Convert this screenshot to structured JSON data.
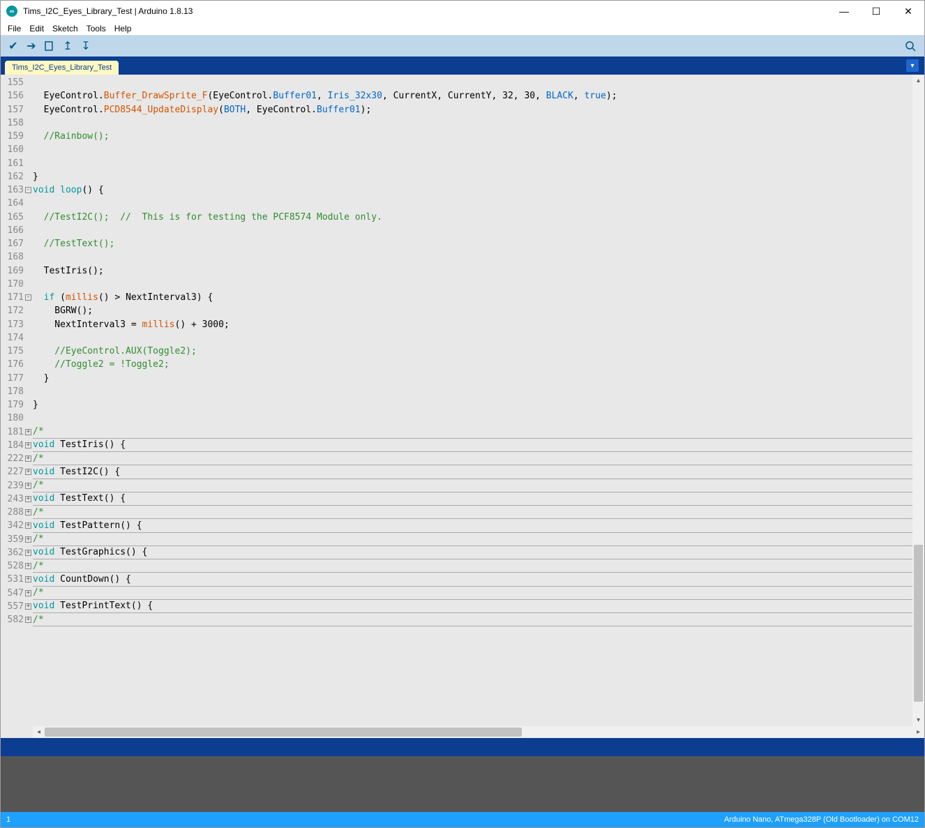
{
  "window": {
    "title": "Tims_I2C_Eyes_Library_Test | Arduino 1.8.13"
  },
  "menu": {
    "file": "File",
    "edit": "Edit",
    "sketch": "Sketch",
    "tools": "Tools",
    "help": "Help"
  },
  "tab": {
    "name": "Tims_I2C_Eyes_Library_Test"
  },
  "status": {
    "left": "1",
    "right": "Arduino Nano, ATmega328P (Old Bootloader) on COM12"
  },
  "gutter": [
    {
      "n": "155"
    },
    {
      "n": "156"
    },
    {
      "n": "157"
    },
    {
      "n": "158"
    },
    {
      "n": "159"
    },
    {
      "n": "160"
    },
    {
      "n": "161"
    },
    {
      "n": "162"
    },
    {
      "n": "163",
      "f": "-"
    },
    {
      "n": "164"
    },
    {
      "n": "165"
    },
    {
      "n": "166"
    },
    {
      "n": "167"
    },
    {
      "n": "168"
    },
    {
      "n": "169"
    },
    {
      "n": "170"
    },
    {
      "n": "171",
      "f": "-"
    },
    {
      "n": "172"
    },
    {
      "n": "173"
    },
    {
      "n": "174"
    },
    {
      "n": "175"
    },
    {
      "n": "176"
    },
    {
      "n": "177"
    },
    {
      "n": "178"
    },
    {
      "n": "179"
    },
    {
      "n": "180"
    },
    {
      "n": "181",
      "f": "+"
    },
    {
      "n": "184",
      "f": "+"
    },
    {
      "n": "222",
      "f": "+"
    },
    {
      "n": "227",
      "f": "+"
    },
    {
      "n": "239",
      "f": "+"
    },
    {
      "n": "243",
      "f": "+"
    },
    {
      "n": "288",
      "f": "+"
    },
    {
      "n": "342",
      "f": "+"
    },
    {
      "n": "359",
      "f": "+"
    },
    {
      "n": "362",
      "f": "+"
    },
    {
      "n": "528",
      "f": "+"
    },
    {
      "n": "531",
      "f": "+"
    },
    {
      "n": "547",
      "f": "+"
    },
    {
      "n": "557",
      "f": "+"
    },
    {
      "n": "582",
      "f": "+"
    }
  ],
  "code": {
    "l155": "",
    "l156_a": "  EyeControl.",
    "l156_b": "Buffer_DrawSprite_F",
    "l156_c": "(EyeControl.",
    "l156_d": "Buffer01",
    "l156_e": ", ",
    "l156_f": "Iris_32x30",
    "l156_g": ", CurrentX, CurrentY, 32, 30, ",
    "l156_h": "BLACK",
    "l156_i": ", ",
    "l156_j": "true",
    "l156_k": ");",
    "l157_a": "  EyeControl.",
    "l157_b": "PCD8544_UpdateDisplay",
    "l157_c": "(",
    "l157_d": "BOTH",
    "l157_e": ", EyeControl.",
    "l157_f": "Buffer01",
    "l157_g": ");",
    "l158": "",
    "l159": "  //Rainbow();",
    "l160": "",
    "l161": "",
    "l162": "}",
    "l163_a": "void",
    "l163_b": " ",
    "l163_c": "loop",
    "l163_d": "() {",
    "l164": "",
    "l165": "  //TestI2C();  //  This is for testing the PCF8574 Module only.",
    "l166": "",
    "l167": "  //TestText();",
    "l168": "",
    "l169": "  TestIris();",
    "l170": "",
    "l171_a": "  ",
    "l171_b": "if",
    "l171_c": " (",
    "l171_d": "millis",
    "l171_e": "() > NextInterval3) {",
    "l172": "    BGRW();",
    "l173_a": "    NextInterval3 = ",
    "l173_b": "millis",
    "l173_c": "() + 3000;",
    "l174": "",
    "l175": "    //EyeControl.AUX(Toggle2);",
    "l176": "    //Toggle2 = !Toggle2;",
    "l177": "  }",
    "l178": "",
    "l179": "}",
    "l180": "",
    "l181": "/*",
    "l184_a": "void",
    "l184_b": " TestIris() {",
    "l222": "/*",
    "l227_a": "void",
    "l227_b": " TestI2C() {",
    "l239": "/*",
    "l243_a": "void",
    "l243_b": " TestText() {",
    "l288": "/*",
    "l342_a": "void",
    "l342_b": " TestPattern() {",
    "l359": "/*",
    "l362_a": "void",
    "l362_b": " TestGraphics() {",
    "l528": "/*",
    "l531_a": "void",
    "l531_b": " CountDown() {",
    "l547": "/*",
    "l557_a": "void",
    "l557_b": " TestPrintText() {",
    "l582": "/*"
  }
}
